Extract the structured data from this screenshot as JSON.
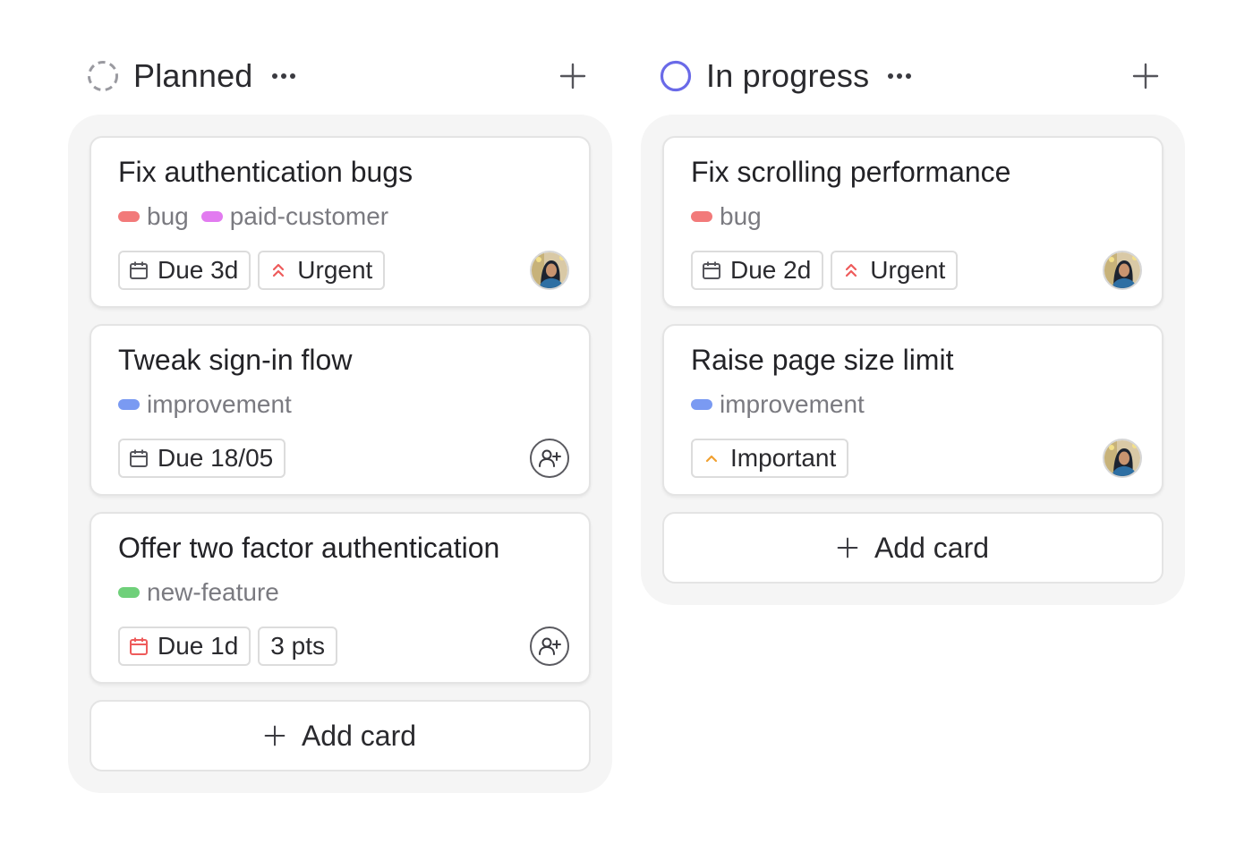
{
  "columns": [
    {
      "title": "Planned",
      "status": "planned",
      "add_card_label": "Add card",
      "cards": [
        {
          "title": "Fix authentication bugs",
          "labels": [
            {
              "name": "bug",
              "color": "#f27a7a"
            },
            {
              "name": "paid-customer",
              "color": "#e27bf0"
            }
          ],
          "chips": [
            {
              "icon": "calendar-icon",
              "text": "Due 3d",
              "icon_color": "#55555b"
            },
            {
              "icon": "urgent-icon",
              "text": "Urgent",
              "icon_color": "#ee5b5b"
            }
          ],
          "assignee": "avatar"
        },
        {
          "title": "Tweak sign-in flow",
          "labels": [
            {
              "name": "improvement",
              "color": "#7a9af2"
            }
          ],
          "chips": [
            {
              "icon": "calendar-icon",
              "text": "Due 18/05",
              "icon_color": "#55555b"
            }
          ],
          "assignee": "assign"
        },
        {
          "title": "Offer two factor authentication",
          "labels": [
            {
              "name": "new-feature",
              "color": "#6fd07a"
            }
          ],
          "chips": [
            {
              "icon": "calendar-icon",
              "text": "Due 1d",
              "icon_color": "#ee5b5b"
            },
            {
              "icon": "",
              "text": "3 pts",
              "icon_color": ""
            }
          ],
          "assignee": "assign"
        }
      ]
    },
    {
      "title": "In progress",
      "status": "progress",
      "add_card_label": "Add card",
      "cards": [
        {
          "title": "Fix scrolling performance",
          "labels": [
            {
              "name": "bug",
              "color": "#f27a7a"
            }
          ],
          "chips": [
            {
              "icon": "calendar-icon",
              "text": "Due 2d",
              "icon_color": "#55555b"
            },
            {
              "icon": "urgent-icon",
              "text": "Urgent",
              "icon_color": "#ee5b5b"
            }
          ],
          "assignee": "avatar"
        },
        {
          "title": "Raise page size limit",
          "labels": [
            {
              "name": "improvement",
              "color": "#7a9af2"
            }
          ],
          "chips": [
            {
              "icon": "important-icon",
              "text": "Important",
              "icon_color": "#f0a030"
            }
          ],
          "assignee": "avatar"
        }
      ]
    }
  ],
  "colors": {
    "planned_status": "#9a9aa0",
    "progress_status": "#6a6ae8",
    "column_bg": "#f5f5f5"
  }
}
